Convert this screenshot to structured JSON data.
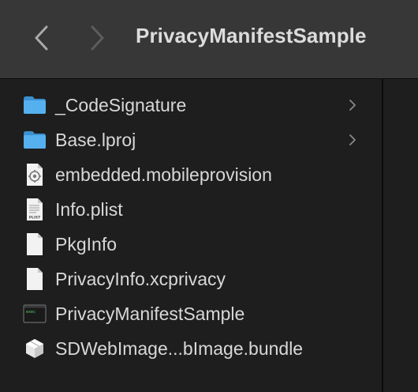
{
  "toolbar": {
    "title": "PrivacyManifestSample",
    "back_icon": "chevron-left-icon",
    "forward_icon": "chevron-right-icon"
  },
  "files": [
    {
      "name": "_CodeSignature",
      "icon": "folder-icon",
      "has_children": true
    },
    {
      "name": "Base.lproj",
      "icon": "folder-icon",
      "has_children": true
    },
    {
      "name": "embedded.mobileprovision",
      "icon": "provisioning-profile-icon",
      "has_children": false
    },
    {
      "name": "Info.plist",
      "icon": "plist-document-icon",
      "has_children": false
    },
    {
      "name": "PkgInfo",
      "icon": "document-icon",
      "has_children": false
    },
    {
      "name": "PrivacyInfo.xcprivacy",
      "icon": "document-icon",
      "has_children": false
    },
    {
      "name": "PrivacyManifestSample",
      "icon": "executable-icon",
      "has_children": false
    },
    {
      "name": "SDWebImage...bImage.bundle",
      "icon": "bundle-icon",
      "has_children": false
    }
  ],
  "colors": {
    "toolbar_bg": "#373737",
    "list_bg": "#1e1e1e",
    "folder": "#4aa6e6",
    "text": "#d8d8d8"
  }
}
